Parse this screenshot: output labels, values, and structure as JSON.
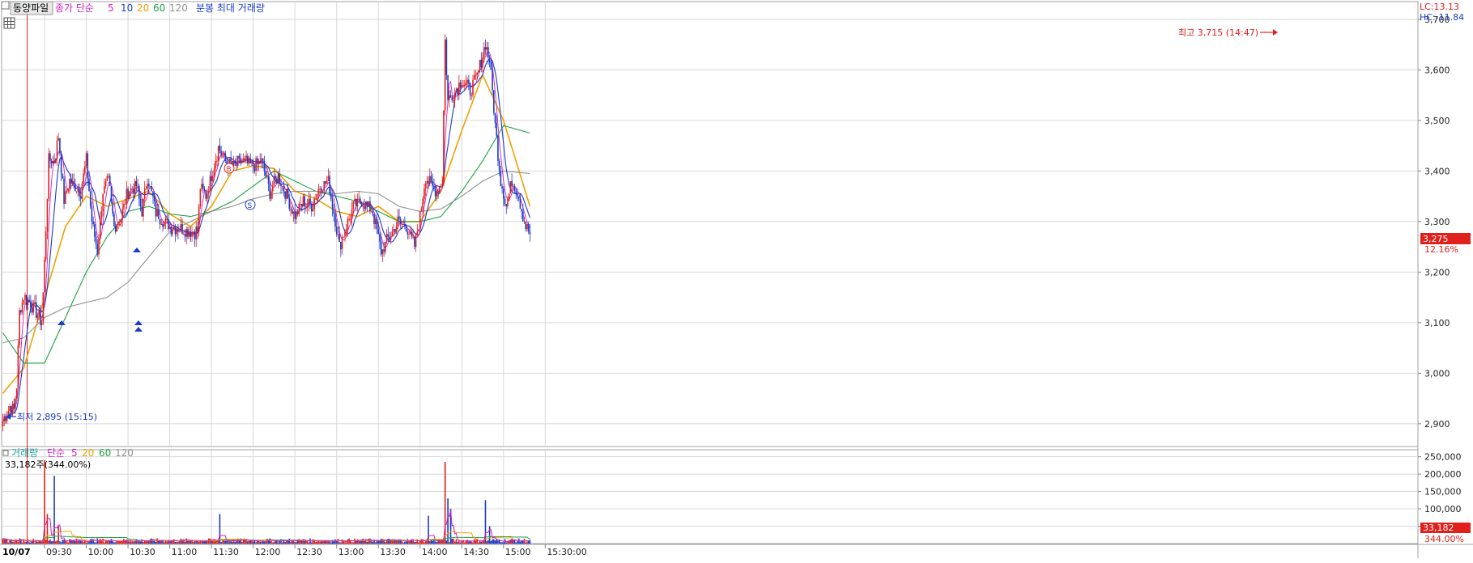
{
  "stock_name": "동양파일",
  "date_label": "10/07",
  "price_legend": {
    "prefix": "종가 단순",
    "periods": [
      "5",
      "10",
      "20",
      "60",
      "120"
    ],
    "suffix": "분봉 최대 거래량"
  },
  "volume_legend": {
    "title": "거래량",
    "type": "단순",
    "periods": [
      "5",
      "20",
      "60",
      "120"
    ],
    "current": "33,182주(344.00%)"
  },
  "lc_label": "LC:13.13",
  "hc_label": "HC:-11.84",
  "high_annotation": "최고 3,715 (14:47)",
  "low_annotation": "최저 2,895 (15:15)",
  "current_price": "3,275",
  "current_change": "12.16%",
  "current_volume": "33,182",
  "current_volume_pct": "344.00%",
  "price_axis": [
    "3,700",
    "3,600",
    "3,500",
    "3,400",
    "3,300",
    "3,200",
    "3,100",
    "3,000",
    "2,900"
  ],
  "volume_axis": [
    "250,000",
    "200,000",
    "150,000",
    "100,000",
    "50,000"
  ],
  "time_axis": [
    "09:30",
    "10:00",
    "10:30",
    "11:00",
    "11:30",
    "12:00",
    "12:30",
    "13:00",
    "13:30",
    "14:00",
    "14:30",
    "15:00",
    "15:30:00"
  ],
  "signal_markers": [
    "B",
    "S"
  ],
  "colors": {
    "up": "#e0201c",
    "down": "#1a3cc8",
    "ma5": "#d020c0",
    "ma10": "#1a3cc8",
    "ma20": "#f0a000",
    "ma60": "#20a040",
    "ma120": "#909090",
    "grid": "#d8d8d8",
    "cursor": "#e02020"
  },
  "chart_data": {
    "type": "candlestick",
    "interval": "1-minute",
    "price_range": [
      2855,
      3735
    ],
    "volume_range": [
      0,
      270000
    ],
    "session": [
      "09:00",
      "15:30"
    ],
    "last_bar": "15:19",
    "price_path": [
      [
        "09:00",
        2905
      ],
      [
        "09:05",
        2935
      ],
      [
        "09:08",
        2925
      ],
      [
        "09:10",
        2975
      ],
      [
        "09:12",
        3120
      ],
      [
        "09:15",
        3150
      ],
      [
        "09:20",
        3140
      ],
      [
        "09:24",
        3120
      ],
      [
        "09:28",
        3100
      ],
      [
        "09:30",
        3220
      ],
      [
        "09:33",
        3420
      ],
      [
        "09:37",
        3420
      ],
      [
        "09:40",
        3470
      ],
      [
        "09:44",
        3340
      ],
      [
        "09:48",
        3380
      ],
      [
        "09:52",
        3370
      ],
      [
        "09:56",
        3360
      ],
      [
        "10:00",
        3420
      ],
      [
        "10:04",
        3300
      ],
      [
        "10:08",
        3240
      ],
      [
        "10:12",
        3360
      ],
      [
        "10:16",
        3380
      ],
      [
        "10:20",
        3290
      ],
      [
        "10:25",
        3310
      ],
      [
        "10:30",
        3360
      ],
      [
        "10:36",
        3370
      ],
      [
        "10:40",
        3320
      ],
      [
        "10:44",
        3390
      ],
      [
        "10:50",
        3320
      ],
      [
        "10:56",
        3300
      ],
      [
        "11:00",
        3290
      ],
      [
        "11:10",
        3285
      ],
      [
        "11:20",
        3280
      ],
      [
        "11:22",
        3370
      ],
      [
        "11:26",
        3350
      ],
      [
        "11:30",
        3390
      ],
      [
        "11:35",
        3445
      ],
      [
        "11:40",
        3420
      ],
      [
        "11:46",
        3410
      ],
      [
        "11:52",
        3420
      ],
      [
        "12:00",
        3410
      ],
      [
        "12:06",
        3420
      ],
      [
        "12:12",
        3360
      ],
      [
        "12:18",
        3390
      ],
      [
        "12:24",
        3350
      ],
      [
        "12:30",
        3310
      ],
      [
        "12:36",
        3340
      ],
      [
        "12:42",
        3330
      ],
      [
        "12:48",
        3370
      ],
      [
        "12:54",
        3380
      ],
      [
        "12:58",
        3320
      ],
      [
        "13:02",
        3250
      ],
      [
        "13:08",
        3300
      ],
      [
        "13:12",
        3330
      ],
      [
        "13:18",
        3340
      ],
      [
        "13:26",
        3320
      ],
      [
        "13:32",
        3240
      ],
      [
        "13:38",
        3270
      ],
      [
        "13:44",
        3300
      ],
      [
        "13:50",
        3290
      ],
      [
        "13:56",
        3250
      ],
      [
        "14:00",
        3310
      ],
      [
        "14:04",
        3390
      ],
      [
        "14:08",
        3370
      ],
      [
        "14:12",
        3360
      ],
      [
        "14:16",
        3380
      ],
      [
        "14:18",
        3660
      ],
      [
        "14:20",
        3540
      ],
      [
        "14:26",
        3560
      ],
      [
        "14:30",
        3580
      ],
      [
        "14:36",
        3560
      ],
      [
        "14:40",
        3580
      ],
      [
        "14:44",
        3620
      ],
      [
        "14:47",
        3650
      ],
      [
        "14:50",
        3620
      ],
      [
        "14:54",
        3490
      ],
      [
        "14:58",
        3380
      ],
      [
        "15:02",
        3330
      ],
      [
        "15:06",
        3380
      ],
      [
        "15:10",
        3360
      ],
      [
        "15:14",
        3310
      ],
      [
        "15:16",
        3290
      ],
      [
        "15:19",
        3275
      ]
    ],
    "moving_averages": [
      {
        "name": "20",
        "points": [
          [
            "09:00",
            2960
          ],
          [
            "09:15",
            3010
          ],
          [
            "09:30",
            3150
          ],
          [
            "09:45",
            3290
          ],
          [
            "10:00",
            3350
          ],
          [
            "10:15",
            3330
          ],
          [
            "10:30",
            3345
          ],
          [
            "10:45",
            3360
          ],
          [
            "11:00",
            3315
          ],
          [
            "11:15",
            3290
          ],
          [
            "11:30",
            3330
          ],
          [
            "11:45",
            3400
          ],
          [
            "12:00",
            3410
          ],
          [
            "12:15",
            3405
          ],
          [
            "12:30",
            3360
          ],
          [
            "12:45",
            3345
          ],
          [
            "13:00",
            3320
          ],
          [
            "13:15",
            3310
          ],
          [
            "13:30",
            3330
          ],
          [
            "13:45",
            3300
          ],
          [
            "14:00",
            3300
          ],
          [
            "14:15",
            3360
          ],
          [
            "14:30",
            3480
          ],
          [
            "14:45",
            3590
          ],
          [
            "15:00",
            3500
          ],
          [
            "15:19",
            3330
          ]
        ]
      },
      {
        "name": "60",
        "points": [
          [
            "09:00",
            3080
          ],
          [
            "09:15",
            3020
          ],
          [
            "09:30",
            3020
          ],
          [
            "09:45",
            3110
          ],
          [
            "10:00",
            3200
          ],
          [
            "10:15",
            3270
          ],
          [
            "10:30",
            3320
          ],
          [
            "10:45",
            3330
          ],
          [
            "11:00",
            3315
          ],
          [
            "11:15",
            3310
          ],
          [
            "11:30",
            3320
          ],
          [
            "11:45",
            3340
          ],
          [
            "12:00",
            3370
          ],
          [
            "12:15",
            3400
          ],
          [
            "12:30",
            3380
          ],
          [
            "12:45",
            3360
          ],
          [
            "13:00",
            3350
          ],
          [
            "13:15",
            3340
          ],
          [
            "13:30",
            3320
          ],
          [
            "13:45",
            3300
          ],
          [
            "14:00",
            3300
          ],
          [
            "14:15",
            3310
          ],
          [
            "14:30",
            3360
          ],
          [
            "14:45",
            3420
          ],
          [
            "15:00",
            3490
          ],
          [
            "15:19",
            3475
          ]
        ]
      },
      {
        "name": "120",
        "points": [
          [
            "09:00",
            3060
          ],
          [
            "09:15",
            3070
          ],
          [
            "09:30",
            3110
          ],
          [
            "09:45",
            3130
          ],
          [
            "10:00",
            3140
          ],
          [
            "10:15",
            3150
          ],
          [
            "10:30",
            3180
          ],
          [
            "10:45",
            3230
          ],
          [
            "11:00",
            3280
          ],
          [
            "11:15",
            3300
          ],
          [
            "11:30",
            3320
          ],
          [
            "11:45",
            3330
          ],
          [
            "12:00",
            3345
          ],
          [
            "12:15",
            3355
          ],
          [
            "12:30",
            3360
          ],
          [
            "12:45",
            3360
          ],
          [
            "13:00",
            3355
          ],
          [
            "13:15",
            3360
          ],
          [
            "13:30",
            3355
          ],
          [
            "13:45",
            3330
          ],
          [
            "14:00",
            3320
          ],
          [
            "14:15",
            3325
          ],
          [
            "14:30",
            3350
          ],
          [
            "14:45",
            3380
          ],
          [
            "15:00",
            3400
          ],
          [
            "15:19",
            3395
          ]
        ]
      }
    ],
    "volume_spikes": [
      [
        "09:30",
        240000
      ],
      [
        "09:32",
        85000
      ],
      [
        "09:37",
        195000
      ],
      [
        "09:40",
        50000
      ],
      [
        "11:36",
        85000
      ],
      [
        "14:06",
        80000
      ],
      [
        "14:18",
        235000
      ],
      [
        "14:20",
        130000
      ],
      [
        "14:22",
        100000
      ],
      [
        "14:47",
        125000
      ],
      [
        "14:50",
        50000
      ]
    ],
    "volume_ma5_peaks": [
      [
        "09:32",
        100000
      ],
      [
        "09:40",
        70000
      ],
      [
        "11:36",
        40000
      ],
      [
        "14:20",
        95000
      ],
      [
        "14:47",
        60000
      ]
    ]
  }
}
